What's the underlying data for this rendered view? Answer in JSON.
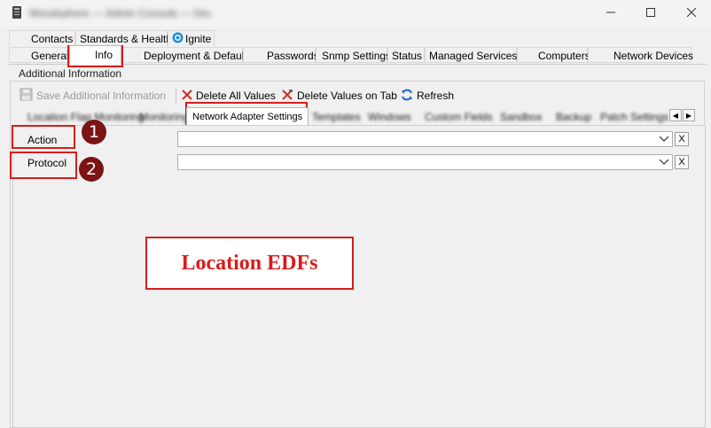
{
  "window": {
    "title": "Woodsphere — Admin Console — Device Manager",
    "controls": {
      "minimize": "—",
      "maximize": "☐",
      "close": "✕"
    }
  },
  "tabs": {
    "row1": [
      {
        "label": "Contacts"
      },
      {
        "label": "Standards & Health"
      },
      {
        "label": "Ignite",
        "icon": "ignite-icon"
      }
    ],
    "row2": [
      {
        "label": "General"
      },
      {
        "label": "Info",
        "selected": true
      },
      {
        "label": "Deployment & Defaults"
      },
      {
        "label": "Passwords"
      },
      {
        "label": "Snmp Settings"
      },
      {
        "label": "Status"
      },
      {
        "label": "Managed Services"
      },
      {
        "label": "Computers"
      },
      {
        "label": "Network Devices"
      }
    ]
  },
  "group_label": "Additional Information",
  "toolbar": {
    "save": "Save Additional Information",
    "delete_all": "Delete All Values",
    "delete_tab": "Delete Values on Tab",
    "refresh": "Refresh"
  },
  "inner_tabs": {
    "items": [
      "Location Flag Monitoring",
      "Monitoring",
      "Network Adapter Settings",
      "Templates",
      "Windows",
      "Custom Fields",
      "Sandbox",
      "Backup",
      "Patch Settings"
    ],
    "active": "Network Adapter Settings"
  },
  "fields": [
    {
      "label": "Action",
      "value": "",
      "clear": "X",
      "badge": "1"
    },
    {
      "label": "Protocol",
      "value": "",
      "clear": "X",
      "badge": "2"
    }
  ],
  "callout": "Location EDFs",
  "colors": {
    "annotation_red": "#d81c1c",
    "badge_dark_red": "#7b1414",
    "refresh_blue": "#1e66c9",
    "delete_red": "#d22a2a"
  }
}
